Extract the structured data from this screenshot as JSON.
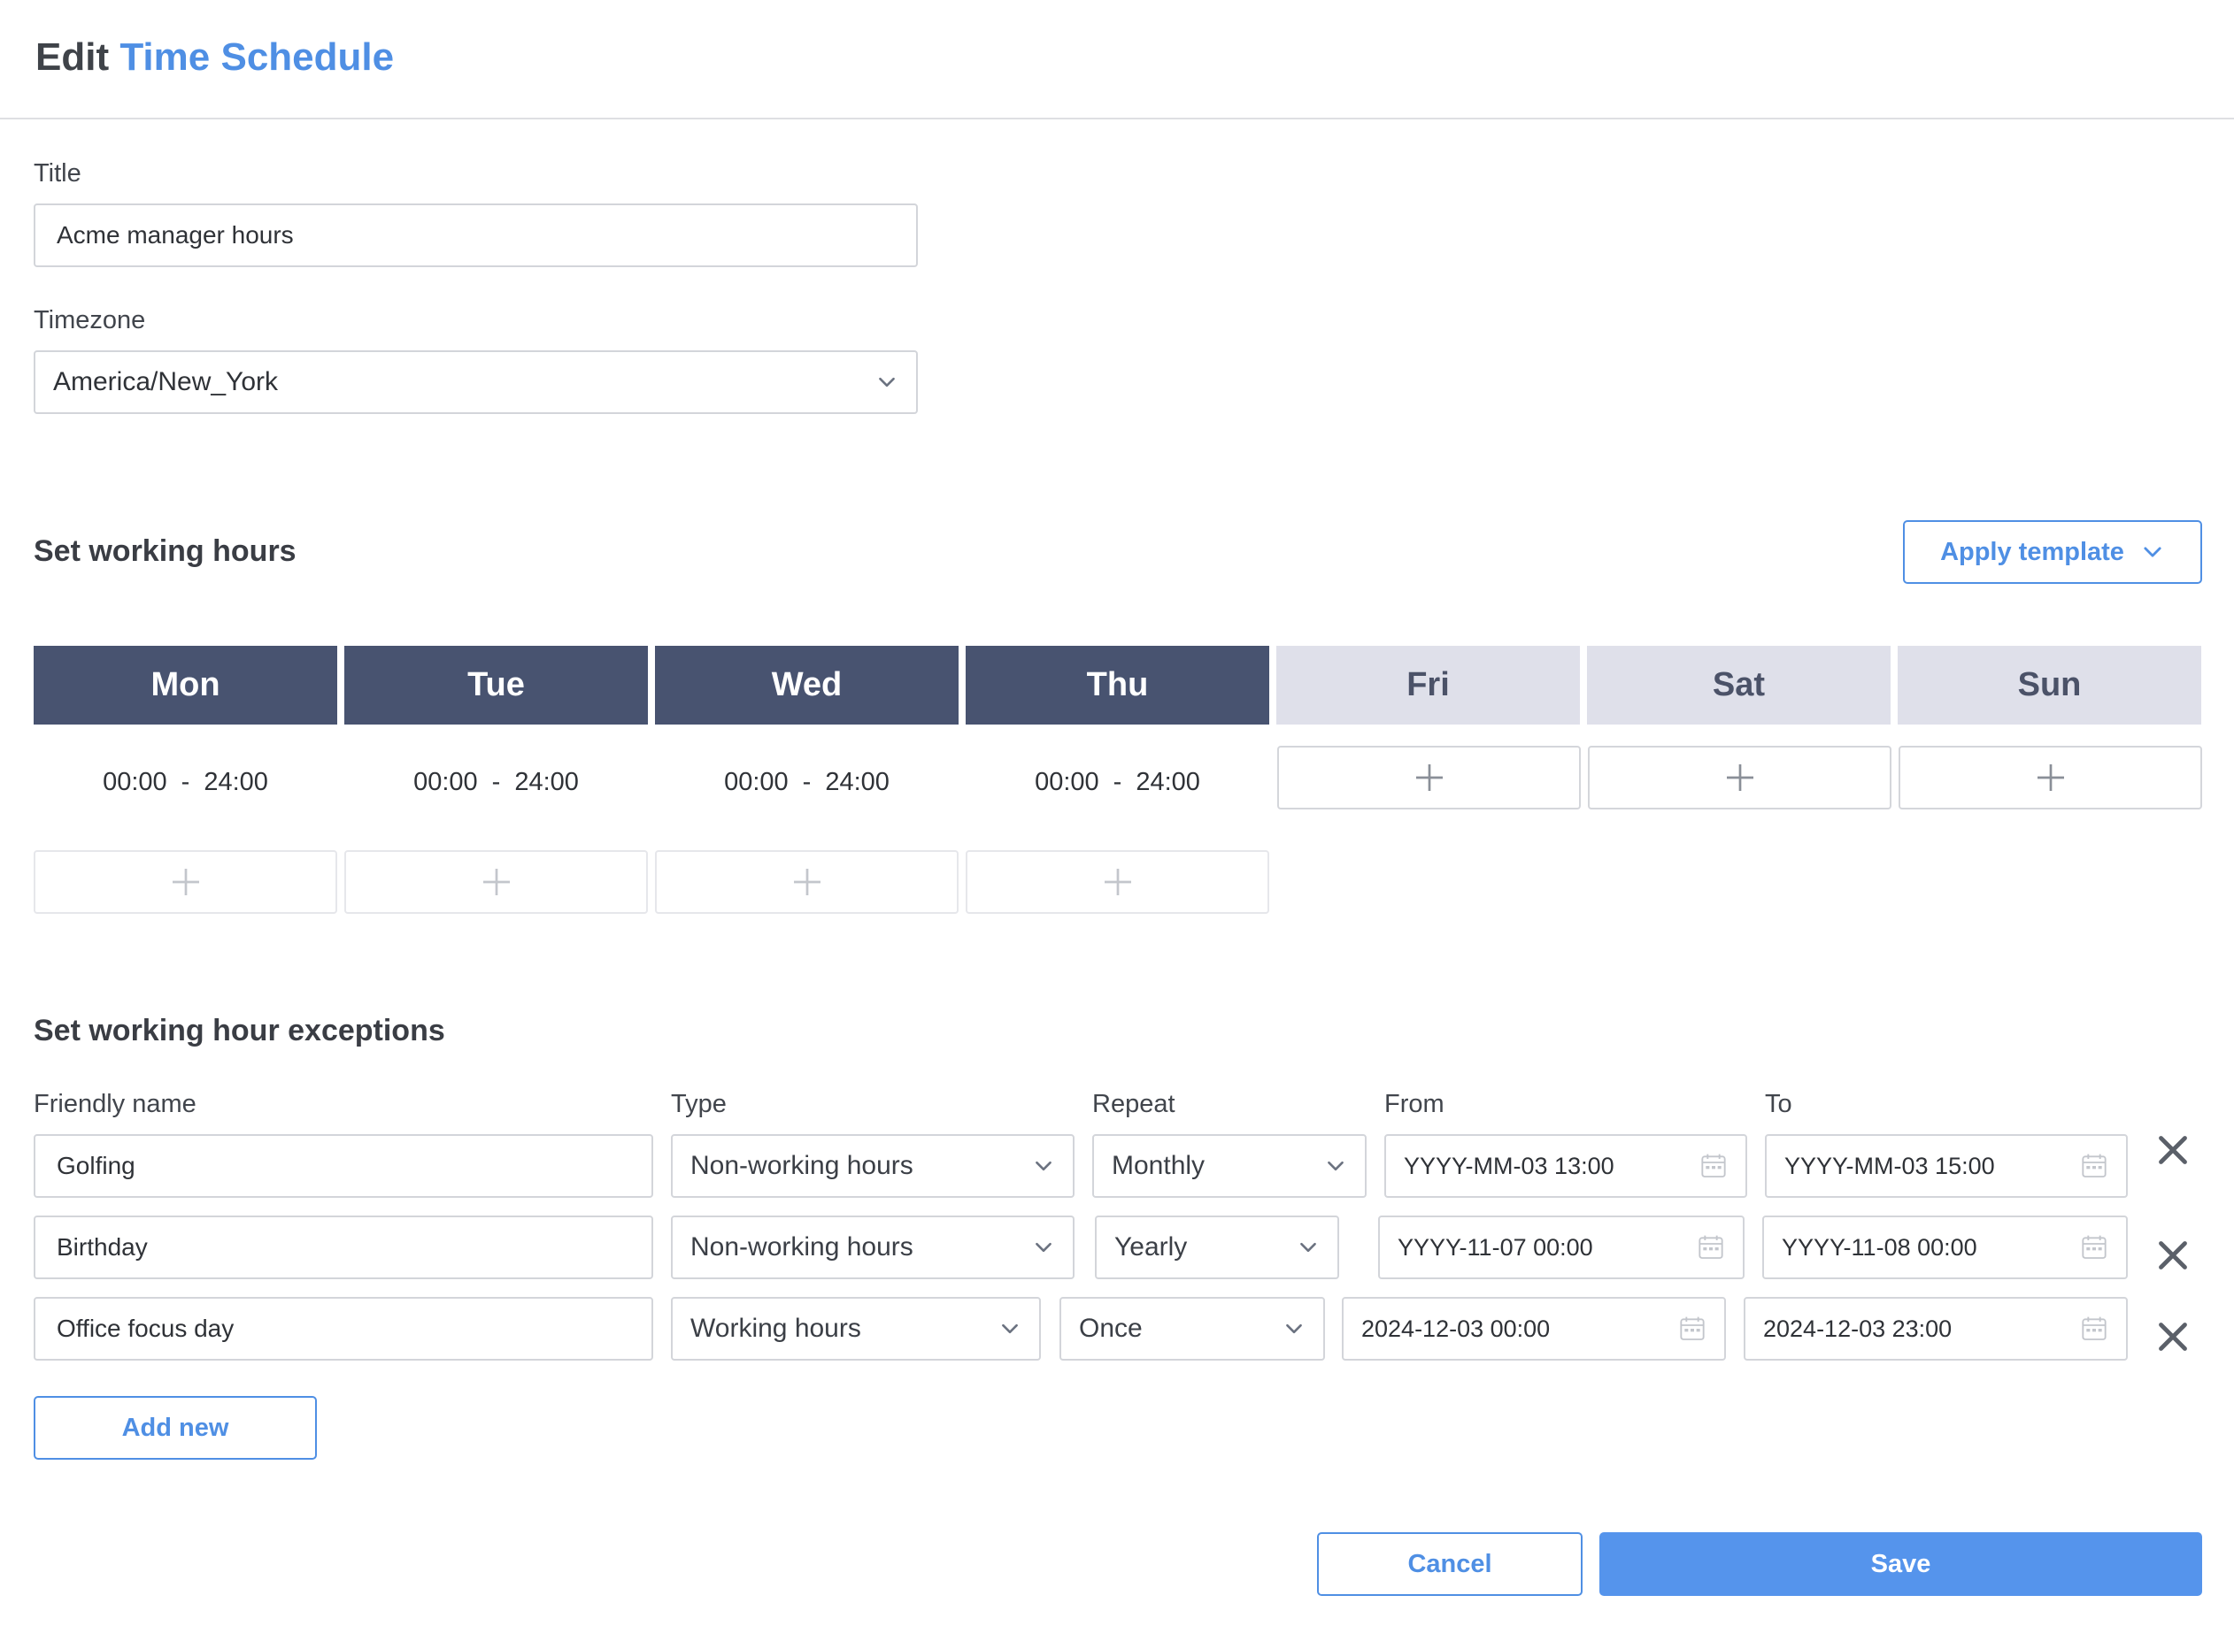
{
  "header": {
    "title_prefix": "Edit",
    "title_accent": "Time Schedule"
  },
  "form": {
    "title_label": "Title",
    "title_value": "Acme manager hours",
    "timezone_label": "Timezone",
    "timezone_value": "America/New_York"
  },
  "working_hours": {
    "section_title": "Set working hours",
    "apply_template_label": "Apply template",
    "days": [
      {
        "label": "Mon",
        "active": true,
        "from": "00:00",
        "to": "24:00"
      },
      {
        "label": "Tue",
        "active": true,
        "from": "00:00",
        "to": "24:00"
      },
      {
        "label": "Wed",
        "active": true,
        "from": "00:00",
        "to": "24:00"
      },
      {
        "label": "Thu",
        "active": true,
        "from": "00:00",
        "to": "24:00"
      },
      {
        "label": "Fri",
        "active": false
      },
      {
        "label": "Sat",
        "active": false
      },
      {
        "label": "Sun",
        "active": false
      }
    ],
    "range_separator": "-"
  },
  "exceptions": {
    "section_title": "Set working hour exceptions",
    "columns": {
      "name": "Friendly name",
      "type": "Type",
      "repeat": "Repeat",
      "from": "From",
      "to": "To"
    },
    "rows": [
      {
        "name": "Golfing",
        "type": "Non-working hours",
        "repeat": "Monthly",
        "from": "YYYY-MM-03 13:00",
        "to": "YYYY-MM-03 15:00"
      },
      {
        "name": "Birthday",
        "type": "Non-working hours",
        "repeat": "Yearly",
        "from": "YYYY-11-07 00:00",
        "to": "YYYY-11-08 00:00"
      },
      {
        "name": "Office focus day",
        "type": "Working hours",
        "repeat": "Once",
        "from": "2024-12-03 00:00",
        "to": "2024-12-03 23:00"
      }
    ],
    "add_new_label": "Add new"
  },
  "footer": {
    "cancel_label": "Cancel",
    "save_label": "Save"
  },
  "colors": {
    "accent": "#4f8fe4",
    "day_active": "#485370",
    "day_inactive": "#dfe0ea",
    "primary_button": "#5594ec"
  },
  "icons": {
    "select": "chevron-down-icon",
    "add": "plus-icon",
    "date": "calendar-icon",
    "remove": "close-icon"
  }
}
